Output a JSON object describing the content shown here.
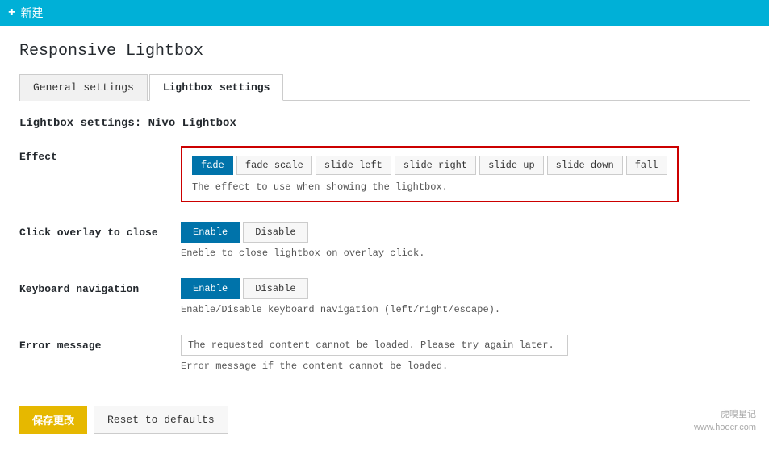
{
  "topbar": {
    "plus_icon": "+",
    "new_label": "新建"
  },
  "page": {
    "title": "Responsive Lightbox",
    "tabs": [
      {
        "id": "general",
        "label": "General settings",
        "active": false
      },
      {
        "id": "lightbox",
        "label": "Lightbox settings",
        "active": true
      }
    ],
    "section_heading": "Lightbox settings: Nivo Lightbox"
  },
  "settings": {
    "effect": {
      "label": "Effect",
      "buttons": [
        {
          "id": "fade",
          "label": "fade",
          "active": true
        },
        {
          "id": "fade-scale",
          "label": "fade scale",
          "active": false
        },
        {
          "id": "slide-left",
          "label": "slide left",
          "active": false
        },
        {
          "id": "slide-right",
          "label": "slide right",
          "active": false
        },
        {
          "id": "slide-up",
          "label": "slide up",
          "active": false
        },
        {
          "id": "slide-down",
          "label": "slide down",
          "active": false
        },
        {
          "id": "fall",
          "label": "fall",
          "active": false
        }
      ],
      "hint": "The effect to use when showing the lightbox."
    },
    "overlay_close": {
      "label": "Click overlay to close",
      "enable_label": "Enable",
      "disable_label": "Disable",
      "enabled": true,
      "hint": "Eneble to close lightbox on overlay click."
    },
    "keyboard_nav": {
      "label": "Keyboard navigation",
      "enable_label": "Enable",
      "disable_label": "Disable",
      "enabled": true,
      "hint": "Enable/Disable keyboard navigation (left/right/escape)."
    },
    "error_message": {
      "label": "Error message",
      "value": "The requested content cannot be loaded. Please try again later.",
      "hint": "Error message if the content cannot be loaded."
    }
  },
  "footer": {
    "save_label": "保存更改",
    "reset_label": "Reset to defaults"
  },
  "watermark": {
    "line1": "虎嗅星记",
    "line2": "www.hoocr.com"
  }
}
